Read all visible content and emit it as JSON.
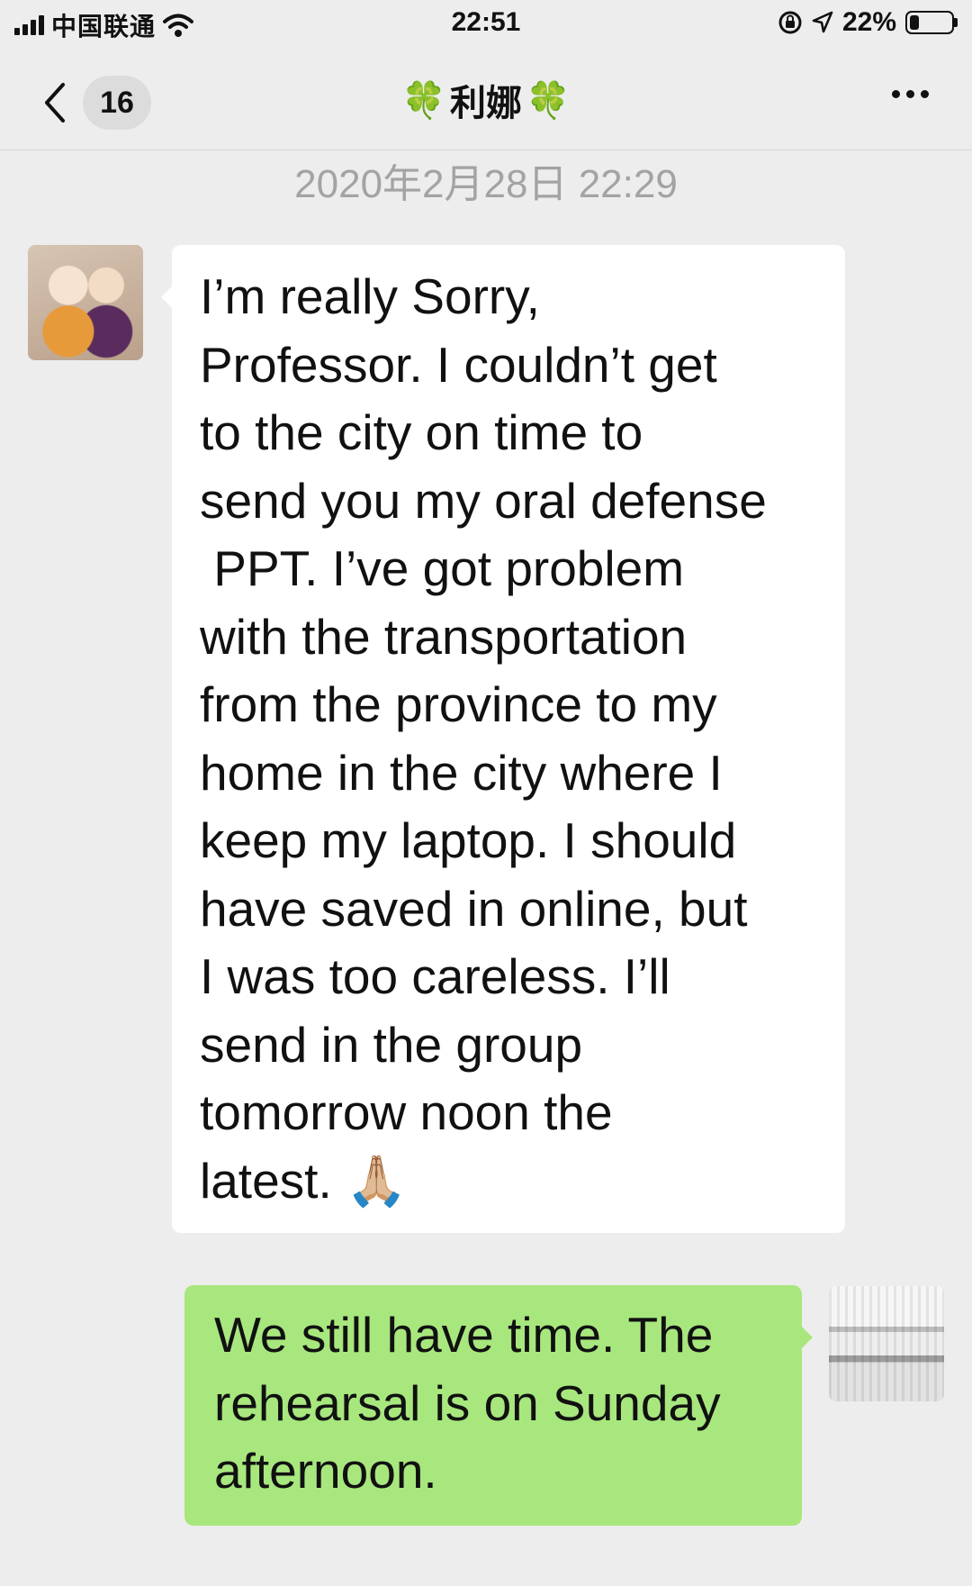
{
  "status_bar": {
    "carrier": "中国联通",
    "time": "22:51",
    "battery_percent": "22%",
    "battery_level": 0.22,
    "icons": [
      "signal-icon",
      "wifi-icon",
      "rotation-lock-icon",
      "location-icon",
      "battery-icon"
    ]
  },
  "nav": {
    "unread_count": "16",
    "title_name": "利娜",
    "title_decoration": "🍀"
  },
  "chat": {
    "timestamp": "2020年2月28日 22:29",
    "messages": [
      {
        "direction": "incoming",
        "lines": [
          "I’m really Sorry,",
          "Professor. I couldn’t get",
          "to the city on time to",
          "send you my oral defense",
          " PPT. I’ve got problem",
          "with the transportation",
          "from the province to my",
          "home in the city where I",
          "keep my laptop. I should",
          "have saved in online, but",
          "I was too careless. I’ll",
          "send in the group",
          "tomorrow noon the",
          "latest. 🙏🏼"
        ]
      },
      {
        "direction": "outgoing",
        "lines": [
          "We still have time. The",
          "rehearsal is on Sunday",
          "afternoon."
        ]
      }
    ]
  },
  "colors": {
    "background": "#ededed",
    "incoming_bubble": "#ffffff",
    "outgoing_bubble": "#a8e77e",
    "timestamp_text": "#a3a3a3"
  }
}
